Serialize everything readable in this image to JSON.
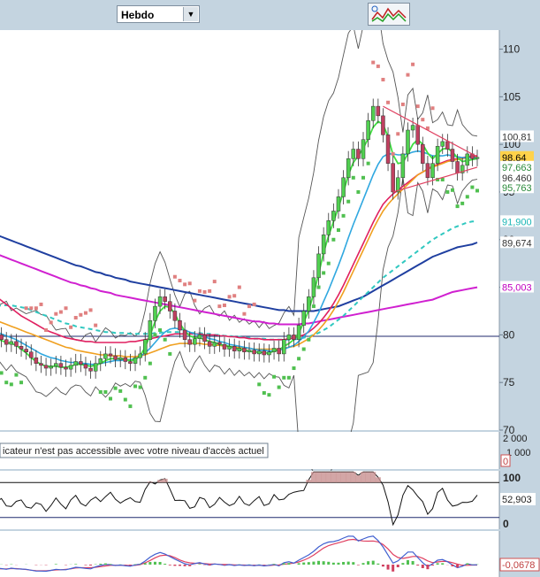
{
  "toolbar": {
    "period_value": "Hebdo",
    "dropdown_icon": "chevron-down-icon",
    "indicator_icon": "indicator-chart-icon"
  },
  "volume_panel": {
    "notice": "icateur n'est pas accessible avec votre niveau d'accès actuel",
    "ticks": [
      "2 000",
      "1 000",
      "0"
    ]
  },
  "price_panel": {
    "ticks": [
      "110",
      "105",
      "100",
      "95",
      "90",
      "85",
      "80",
      "75",
      "70"
    ],
    "value_labels": [
      {
        "text": "100,81",
        "value": 100.81,
        "color": "#333333",
        "bg": "#ffffff"
      },
      {
        "text": "98,64",
        "value": 98.64,
        "color": "#000000",
        "bg": "#ffd24a"
      },
      {
        "text": "97,663",
        "value": 97.663,
        "color": "#2a8a3a",
        "bg": "#ffffff"
      },
      {
        "text": "96,460",
        "value": 96.46,
        "color": "#333333",
        "bg": "#ffffff"
      },
      {
        "text": "95,763",
        "value": 95.763,
        "color": "#2a8a3a",
        "bg": "#ffffff"
      },
      {
        "text": "91,900",
        "value": 91.9,
        "color": "#19b5b5",
        "bg": "#ffffff"
      },
      {
        "text": "89,674",
        "value": 89.674,
        "color": "#333333",
        "bg": "#ffffff"
      },
      {
        "text": "85,003",
        "value": 85.003,
        "color": "#c000c0",
        "bg": "#ffffff"
      }
    ]
  },
  "oscillator_panel": {
    "ticks": [
      "100",
      "0"
    ],
    "value_label": "52,903",
    "value": 52.903,
    "upper_level": 80,
    "lower_level": 20
  },
  "macd_panel": {
    "value_label": "-0,0678",
    "value": -0.0678
  },
  "chart_data": {
    "type": "line",
    "ylim": [
      70,
      112
    ],
    "grid": false,
    "horizontal_line": 80,
    "close": [
      80,
      79.5,
      79,
      79.3,
      78.8,
      78.5,
      78.2,
      77.6,
      77,
      76.8,
      76.5,
      76.7,
      77,
      76.6,
      76.4,
      76.8,
      77.2,
      76.9,
      76.5,
      76.2,
      77,
      77.5,
      78,
      77.8,
      77.4,
      77.6,
      77.2,
      77,
      77.6,
      78,
      79.5,
      81.5,
      83,
      84,
      83.5,
      82.5,
      81.5,
      80.5,
      79.5,
      79,
      79.6,
      80,
      79.3,
      78.8,
      79.2,
      79,
      78.5,
      78.8,
      78.3,
      78.6,
      78.2,
      78.4,
      78,
      78.3,
      77.9,
      78.2,
      78.6,
      78,
      79.5,
      80,
      79.5,
      81,
      82.5,
      84,
      86,
      88.5,
      90.5,
      92,
      93,
      94.5,
      96.5,
      98.5,
      99.5,
      98.5,
      100.5,
      102.5,
      104,
      103,
      101,
      98,
      95,
      96.5,
      99,
      101.5,
      102,
      100,
      98,
      96.5,
      98,
      99.8,
      100.3,
      99.5,
      98.2,
      97,
      97.8,
      99,
      98.5,
      98.64
    ],
    "sma_short": [
      79.6,
      79.4,
      79.2,
      79.1,
      78.9,
      78.5,
      78.1,
      77.6,
      77.2,
      76.9,
      76.7,
      76.7,
      76.7,
      76.6,
      76.6,
      76.7,
      76.9,
      76.9,
      76.8,
      76.7,
      76.8,
      77,
      77.3,
      77.5,
      77.5,
      77.5,
      77.4,
      77.3,
      77.4,
      77.8,
      78.7,
      80,
      81.4,
      82.5,
      83,
      82.9,
      82.2,
      81.2,
      80.4,
      79.9,
      79.7,
      79.7,
      79.5,
      79.3,
      79.2,
      79,
      78.9,
      78.8,
      78.6,
      78.5,
      78.4,
      78.3,
      78.2,
      78.2,
      78.1,
      78.1,
      78.3,
      78.4,
      78.8,
      79.1,
      79.5,
      80.2,
      81.3,
      82.6,
      84.3,
      86.4,
      88.6,
      90.4,
      91.9,
      93.4,
      95,
      96.8,
      98.1,
      98.8,
      99.6,
      100.6,
      101.8,
      102.4,
      102.1,
      100.8,
      98.9,
      98,
      98.1,
      99,
      100,
      100.5,
      100,
      99.1,
      98.5,
      99,
      99.5,
      99.6,
      99.2,
      98.6,
      98.2,
      98.3,
      98.4,
      98.5
    ],
    "sma_medium": [
      80.3,
      80.1,
      79.9,
      79.7,
      79.5,
      79.2,
      78.9,
      78.6,
      78.3,
      78,
      77.8,
      77.6,
      77.5,
      77.3,
      77.2,
      77.1,
      77.1,
      77,
      77,
      76.9,
      76.9,
      77,
      77.1,
      77.2,
      77.3,
      77.3,
      77.4,
      77.4,
      77.5,
      77.7,
      78.1,
      78.6,
      79.2,
      79.8,
      80.3,
      80.6,
      80.7,
      80.6,
      80.5,
      80.3,
      80.1,
      80,
      79.8,
      79.6,
      79.5,
      79.3,
      79.2,
      79,
      78.9,
      78.8,
      78.7,
      78.6,
      78.5,
      78.4,
      78.4,
      78.3,
      78.3,
      78.4,
      78.5,
      78.7,
      78.9,
      79.3,
      79.8,
      80.4,
      81.3,
      82.3,
      83.5,
      84.7,
      86,
      87.3,
      88.7,
      90.2,
      91.6,
      92.9,
      94.2,
      95.5,
      96.8,
      97.9,
      98.7,
      99,
      99,
      98.9,
      98.9,
      99,
      99.2,
      99.3,
      99.2,
      99,
      98.8,
      98.8,
      98.8,
      98.9,
      98.8,
      98.7,
      98.6,
      98.6,
      98.6,
      98.6
    ],
    "sma_long_orange": [
      81.5,
      81.3,
      81.1,
      80.9,
      80.7,
      80.5,
      80.3,
      80.1,
      79.9,
      79.7,
      79.5,
      79.3,
      79.1,
      78.9,
      78.7,
      78.6,
      78.4,
      78.3,
      78.2,
      78.1,
      78,
      77.9,
      77.9,
      77.8,
      77.8,
      77.8,
      77.7,
      77.7,
      77.7,
      77.8,
      77.9,
      78.1,
      78.3,
      78.5,
      78.7,
      78.9,
      79,
      79.1,
      79.1,
      79.1,
      79.1,
      79.1,
      79,
      79,
      78.9,
      78.9,
      78.8,
      78.8,
      78.7,
      78.7,
      78.6,
      78.6,
      78.5,
      78.5,
      78.5,
      78.5,
      78.5,
      78.5,
      78.6,
      78.7,
      78.8,
      79,
      79.3,
      79.6,
      80,
      80.5,
      81.1,
      81.8,
      82.6,
      83.5,
      84.5,
      85.6,
      86.7,
      87.8,
      88.9,
      90,
      91.1,
      92.1,
      93,
      93.7,
      94.3,
      94.8,
      95.3,
      95.8,
      96.3,
      96.8,
      97.1,
      97.4,
      97.6,
      97.8,
      98,
      98.2,
      98.3,
      98.4,
      98.5,
      98.6,
      98.6,
      98.7
    ],
    "sma_crimson": [
      84,
      83.6,
      83.2,
      82.8,
      82.4,
      82,
      81.7,
      81.4,
      81.1,
      80.8,
      80.5,
      80.3,
      80.1,
      79.9,
      79.7,
      79.6,
      79.5,
      79.4,
      79.3,
      79.3,
      79.2,
      79.2,
      79.2,
      79.2,
      79.2,
      79.2,
      79.2,
      79.3,
      79.3,
      79.4,
      79.5,
      79.6,
      79.7,
      79.8,
      79.9,
      80,
      80.1,
      80.1,
      80.1,
      80.1,
      80.1,
      80.1,
      80,
      80,
      80,
      79.9,
      79.9,
      79.8,
      79.8,
      79.7,
      79.7,
      79.6,
      79.6,
      79.6,
      79.5,
      79.5,
      79.5,
      79.5,
      79.5,
      79.6,
      79.7,
      79.8,
      80,
      80.3,
      80.7,
      81.2,
      81.8,
      82.5,
      83.3,
      84.2,
      85.2,
      86.3,
      87.4,
      88.5,
      89.6,
      90.7,
      91.8,
      92.8,
      93.7,
      94.3,
      94.8,
      95.2,
      95.6,
      96,
      96.4,
      96.8,
      97.1,
      97.4,
      97.7,
      97.9,
      98.1,
      98.3,
      98.4,
      98.5,
      98.6,
      98.7,
      98.8,
      98.8
    ],
    "ema_teal_dashed": [
      83,
      83.1,
      83.1,
      83.1,
      83,
      82.9,
      82.8,
      82.6,
      82.4,
      82.2,
      82,
      81.8,
      81.6,
      81.4,
      81.2,
      81.1,
      80.9,
      80.8,
      80.7,
      80.6,
      80.5,
      80.4,
      80.3,
      80.3,
      80.2,
      80.2,
      80.2,
      80.1,
      80.1,
      80.1,
      80.1,
      80.1,
      80.2,
      80.2,
      80.3,
      80.3,
      80.3,
      80.3,
      80.3,
      80.2,
      80.2,
      80.2,
      80.1,
      80.1,
      80,
      80,
      79.9,
      79.9,
      79.8,
      79.8,
      79.7,
      79.7,
      79.6,
      79.6,
      79.6,
      79.5,
      79.5,
      79.5,
      79.5,
      79.5,
      79.5,
      79.6,
      79.7,
      79.8,
      80,
      80.2,
      80.5,
      80.8,
      81.2,
      81.6,
      82,
      82.5,
      83,
      83.5,
      84,
      84.5,
      85,
      85.5,
      86,
      86.4,
      86.8,
      87.2,
      87.6,
      88,
      88.4,
      88.8,
      89.2,
      89.6,
      90,
      90.3,
      90.6,
      90.9,
      91.2,
      91.4,
      91.6,
      91.8,
      91.9,
      91.9
    ],
    "sma_blue": [
      90.5,
      90.3,
      90.1,
      89.9,
      89.7,
      89.5,
      89.3,
      89.1,
      88.9,
      88.7,
      88.5,
      88.3,
      88.1,
      87.9,
      87.7,
      87.5,
      87.3,
      87.2,
      87,
      86.8,
      86.6,
      86.5,
      86.3,
      86.2,
      86,
      85.9,
      85.8,
      85.6,
      85.5,
      85.4,
      85.3,
      85.2,
      85.1,
      85,
      84.9,
      84.8,
      84.7,
      84.6,
      84.5,
      84.4,
      84.3,
      84.2,
      84.1,
      84,
      83.9,
      83.8,
      83.7,
      83.6,
      83.5,
      83.4,
      83.3,
      83.2,
      83.1,
      83,
      82.9,
      82.8,
      82.7,
      82.6,
      82.6,
      82.5,
      82.5,
      82.5,
      82.5,
      82.5,
      82.5,
      82.6,
      82.7,
      82.8,
      82.9,
      83,
      83.2,
      83.4,
      83.6,
      83.8,
      84,
      84.3,
      84.6,
      84.9,
      85.2,
      85.5,
      85.8,
      86.1,
      86.4,
      86.7,
      87,
      87.3,
      87.6,
      87.9,
      88.2,
      88.4,
      88.6,
      88.8,
      89,
      89.2,
      89.3,
      89.4,
      89.5,
      89.7
    ],
    "sma_magenta": [
      88.5,
      88.3,
      88.1,
      87.9,
      87.7,
      87.5,
      87.3,
      87.1,
      86.9,
      86.7,
      86.5,
      86.3,
      86.1,
      85.9,
      85.7,
      85.5,
      85.4,
      85.2,
      85.1,
      84.9,
      84.8,
      84.6,
      84.5,
      84.4,
      84.2,
      84.1,
      84,
      83.9,
      83.8,
      83.7,
      83.6,
      83.5,
      83.4,
      83.3,
      83.2,
      83.1,
      83,
      82.9,
      82.8,
      82.7,
      82.6,
      82.5,
      82.4,
      82.3,
      82.2,
      82.1,
      82,
      81.9,
      81.8,
      81.7,
      81.6,
      81.5,
      81.4,
      81.4,
      81.3,
      81.2,
      81.2,
      81.1,
      81.1,
      81.1,
      81.1,
      81.1,
      81.2,
      81.2,
      81.3,
      81.4,
      81.5,
      81.6,
      81.7,
      81.8,
      81.9,
      82,
      82.1,
      82.2,
      82.3,
      82.4,
      82.5,
      82.6,
      82.7,
      82.8,
      82.9,
      83,
      83.1,
      83.2,
      83.3,
      83.4,
      83.5,
      83.6,
      83.7,
      83.9,
      84.1,
      84.3,
      84.5,
      84.6,
      84.7,
      84.8,
      84.9,
      85
    ]
  }
}
